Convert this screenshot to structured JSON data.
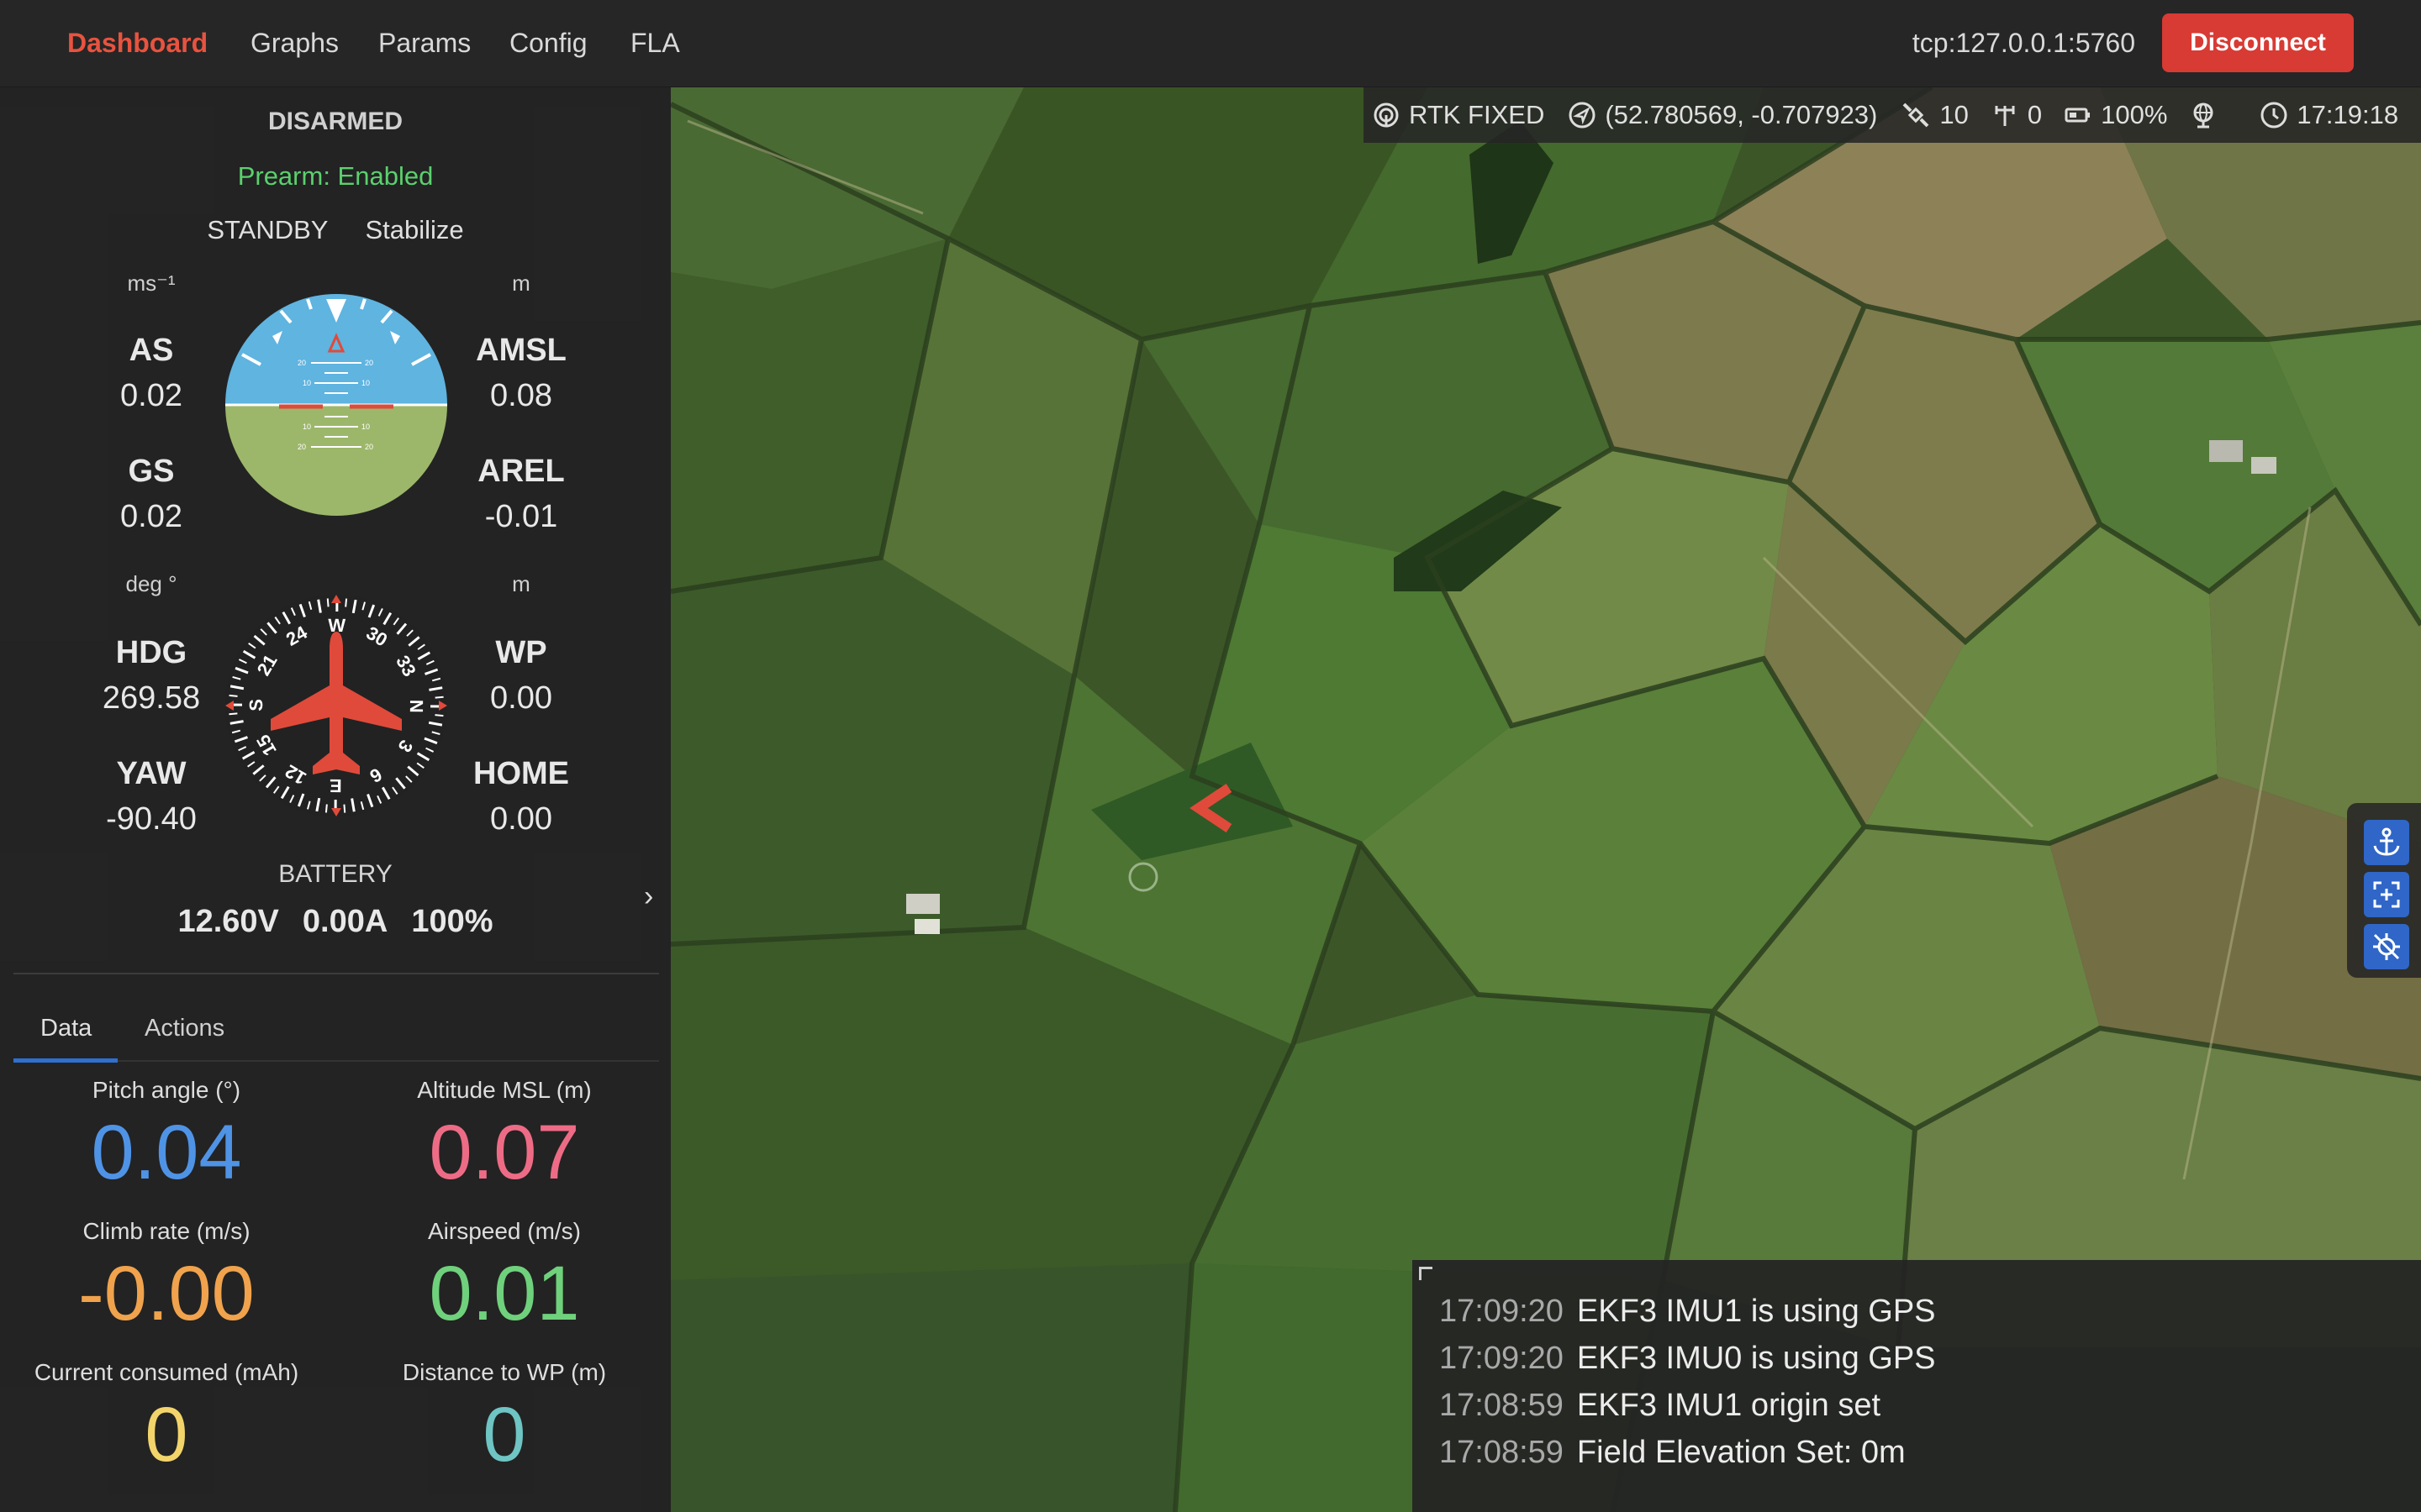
{
  "navbar": {
    "links": [
      {
        "label": "Dashboard",
        "active": true
      },
      {
        "label": "Graphs"
      },
      {
        "label": "Params"
      },
      {
        "label": "Config"
      },
      {
        "label": "FLA"
      }
    ],
    "connection_address": "tcp:127.0.0.1:5760",
    "disconnect_label": "Disconnect"
  },
  "status_bar": {
    "gps_fix": "RTK FIXED",
    "position": "(52.780569, -0.707923)",
    "satellites": "10",
    "signal": "0",
    "battery": "100%",
    "time": "17:19:18"
  },
  "vehicle": {
    "arm_state": "DISARMED",
    "prearm": "Prearm: Enabled",
    "system_status": "STANDBY",
    "flight_mode": "Stabilize"
  },
  "indicators": {
    "speed_unit": "ms⁻¹",
    "alt_unit": "m",
    "angle_unit": "deg °",
    "dist_unit": "m",
    "as": {
      "label": "AS",
      "value": "0.02"
    },
    "gs": {
      "label": "GS",
      "value": "0.02"
    },
    "amsl": {
      "label": "AMSL",
      "value": "0.08"
    },
    "arel": {
      "label": "AREL",
      "value": "-0.01"
    },
    "hdg": {
      "label": "HDG",
      "value": "269.58"
    },
    "yaw": {
      "label": "YAW",
      "value": "-90.40"
    },
    "wp": {
      "label": "WP",
      "value": "0.00"
    },
    "home": {
      "label": "HOME",
      "value": "0.00"
    },
    "heading_deg": 269.58,
    "compass_labels": [
      "N",
      "3",
      "6",
      "E",
      "12",
      "15",
      "S",
      "21",
      "24",
      "W",
      "30",
      "33"
    ],
    "pitch_ladder": [
      "20",
      "10",
      "10",
      "20"
    ]
  },
  "battery": {
    "label": "BATTERY",
    "voltage": "12.60V",
    "current": "0.00A",
    "remaining": "100%"
  },
  "tabs": {
    "data": "Data",
    "actions": "Actions"
  },
  "tiles": [
    {
      "label": "Pitch angle (°)",
      "value": "0.04",
      "color": "#4f93e6"
    },
    {
      "label": "Altitude MSL (m)",
      "value": "0.07",
      "color": "#ee6b86"
    },
    {
      "label": "Climb rate (m/s)",
      "value": "-0.00",
      "color": "#f0a34c"
    },
    {
      "label": "Airspeed (m/s)",
      "value": "0.01",
      "color": "#6fd17c"
    },
    {
      "label": "Current consumed (mAh)",
      "value": "0",
      "color": "#f2d46b"
    },
    {
      "label": "Distance to WP (m)",
      "value": "0",
      "color": "#6fc4c4"
    }
  ],
  "messages": [
    {
      "time": "17:09:20",
      "text": "EKF3 IMU1 is using GPS"
    },
    {
      "time": "17:09:20",
      "text": "EKF3 IMU0 is using GPS"
    },
    {
      "time": "17:08:59",
      "text": "EKF3 IMU1 origin set"
    },
    {
      "time": "17:08:59",
      "text": "Field Elevation Set: 0m"
    }
  ],
  "colors": {
    "accent": "#e8533f",
    "disconnect": "#d83a34",
    "prearm_ok": "#5bd06e",
    "sky": "#5fb4e0",
    "ground": "#9cb76a",
    "map_button": "#2f66c7"
  }
}
